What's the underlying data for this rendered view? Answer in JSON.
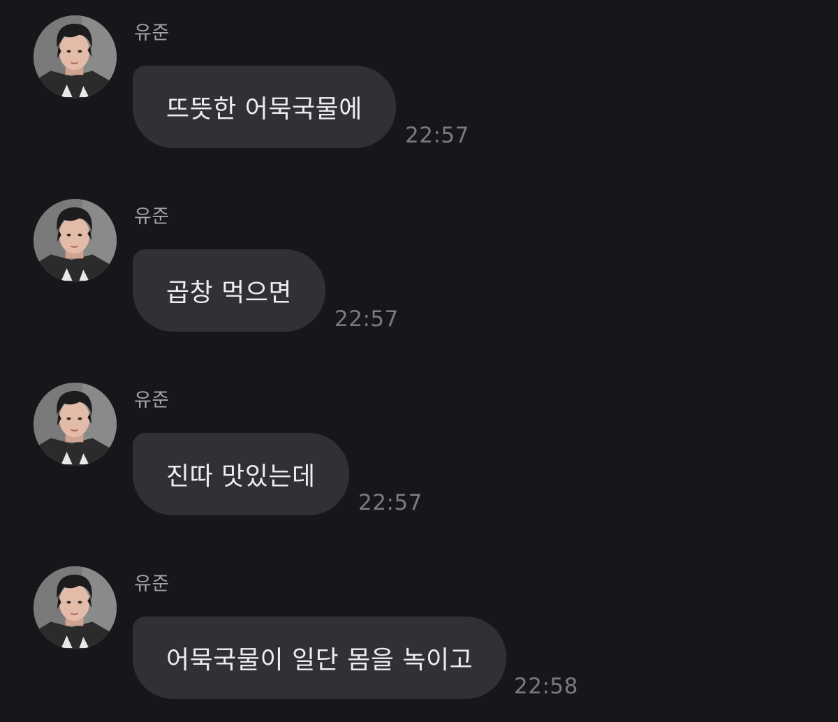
{
  "chat": {
    "messages": [
      {
        "sender": "유준",
        "text": "뜨뜻한 어묵국물에",
        "time": "22:57",
        "avatar_icon": "profile-photo"
      },
      {
        "sender": "유준",
        "text": "곱창 먹으면",
        "time": "22:57",
        "avatar_icon": "profile-photo"
      },
      {
        "sender": "유준",
        "text": "진따 맛있는데",
        "time": "22:57",
        "avatar_icon": "profile-photo"
      },
      {
        "sender": "유준",
        "text": "어묵국물이 일단 몸을 녹이고",
        "time": "22:58",
        "avatar_icon": "profile-photo"
      }
    ]
  },
  "colors": {
    "background": "#17171b",
    "bubble": "#2f3136",
    "message_text": "#eeeef0",
    "sender_text": "#a4a4a8",
    "time_text": "#7a7a80"
  }
}
